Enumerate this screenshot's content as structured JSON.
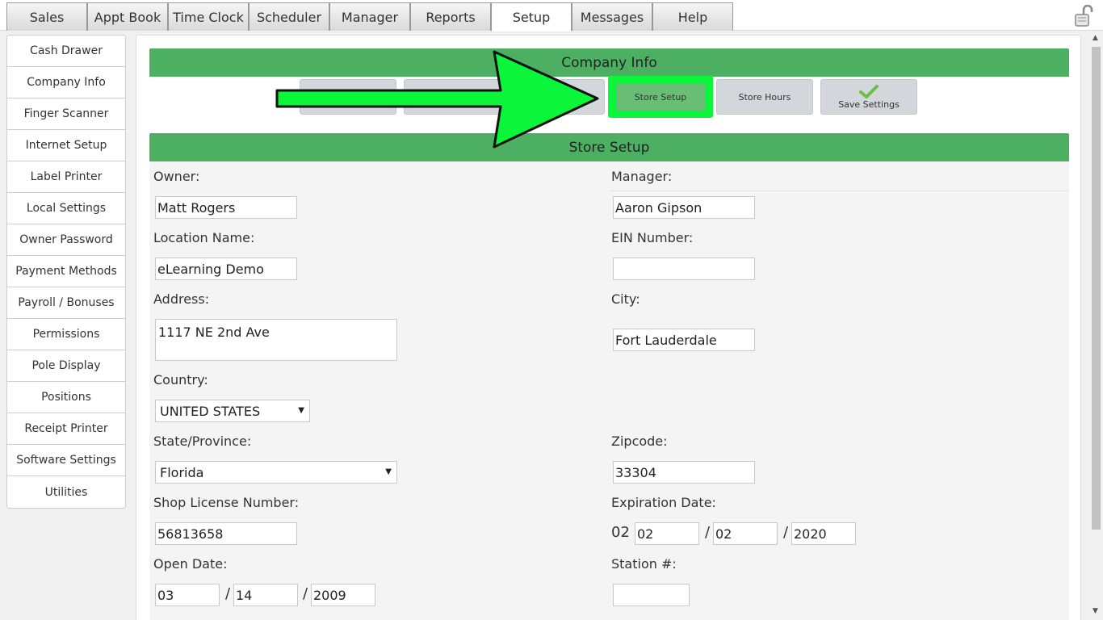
{
  "tabs": [
    {
      "label": "Sales"
    },
    {
      "label": "Appt Book"
    },
    {
      "label": "Time Clock"
    },
    {
      "label": "Scheduler"
    },
    {
      "label": "Manager"
    },
    {
      "label": "Reports"
    },
    {
      "label": "Setup"
    },
    {
      "label": "Messages"
    },
    {
      "label": "Help"
    }
  ],
  "active_tab": "Setup",
  "sidebar": {
    "items": [
      {
        "label": "Cash Drawer"
      },
      {
        "label": "Company Info"
      },
      {
        "label": "Finger Scanner"
      },
      {
        "label": "Internet Setup"
      },
      {
        "label": "Label Printer"
      },
      {
        "label": "Local Settings"
      },
      {
        "label": "Owner Password"
      },
      {
        "label": "Payment Methods"
      },
      {
        "label": "Payroll / Bonuses"
      },
      {
        "label": "Permissions"
      },
      {
        "label": "Pole Display"
      },
      {
        "label": "Positions"
      },
      {
        "label": "Receipt Printer"
      },
      {
        "label": "Software Settings"
      },
      {
        "label": "Utilities"
      }
    ]
  },
  "section": {
    "title": "Company Info",
    "buttons": {
      "store_setup": "Store Setup",
      "store_hours": "Store Hours",
      "save_settings": "Save Settings"
    }
  },
  "store_setup": {
    "title": "Store Setup",
    "owner_label": "Owner:",
    "owner_value": "Matt Rogers",
    "manager_label": "Manager:",
    "manager_value": "Aaron Gipson",
    "location_label": "Location Name:",
    "location_value": "eLearning Demo",
    "ein_label": "EIN Number:",
    "ein_value": "",
    "address_label": "Address:",
    "address_value": "1117 NE 2nd Ave",
    "city_label": "City:",
    "city_value": "Fort Lauderdale",
    "country_label": "Country:",
    "country_value": "UNITED STATES",
    "state_label": "State/Province:",
    "state_value": "Florida",
    "zip_label": "Zipcode:",
    "zip_value": "33304",
    "license_label": "Shop License Number:",
    "license_value": "56813658",
    "expiration_label": "Expiration Date:",
    "expiration_prefix": "02",
    "expiration_month": "02",
    "expiration_day": "02",
    "expiration_year": "2020",
    "open_label": "Open Date:",
    "open_month": "03",
    "open_day": "14",
    "open_year": "2009",
    "station_label": "Station #:",
    "station_value": "",
    "slash": "/"
  },
  "colors": {
    "green_bar": "#4caf62",
    "highlight": "#0bf53b"
  },
  "icons": {
    "lock": "padlock-icon",
    "save": "checkmark-icon",
    "dropdown": "caret-down-icon"
  }
}
